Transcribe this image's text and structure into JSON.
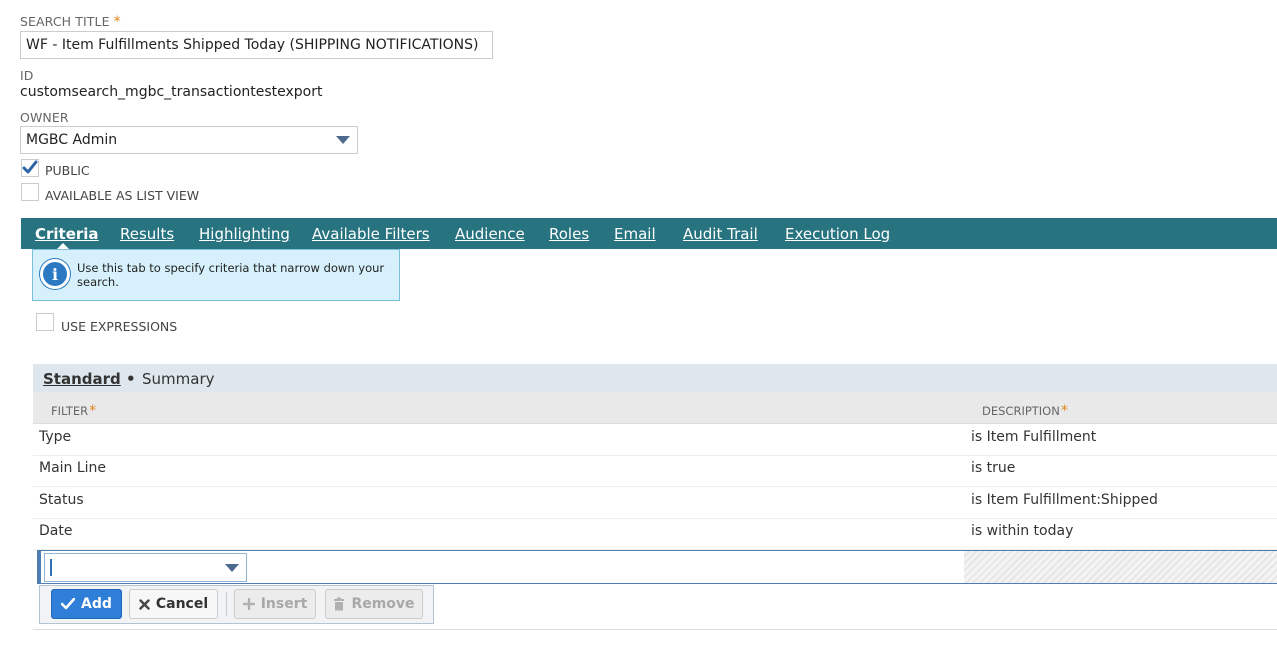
{
  "form": {
    "search_title_label": "SEARCH TITLE",
    "required_mark": "*",
    "search_title_value": "WF - Item Fulfillments Shipped Today (SHIPPING NOTIFICATIONS)",
    "id_label": "ID",
    "id_value": "customsearch_mgbc_transactiontestexport",
    "owner_label": "OWNER",
    "owner_value": "MGBC Admin",
    "public_label": "PUBLIC",
    "public_checked": true,
    "list_view_label": "AVAILABLE AS LIST VIEW",
    "list_view_checked": false
  },
  "tabs": [
    {
      "label": "Criteria",
      "active": true
    },
    {
      "label": "Results"
    },
    {
      "label": "Highlighting"
    },
    {
      "label": "Available Filters"
    },
    {
      "label": "Audience"
    },
    {
      "label": "Roles"
    },
    {
      "label": "Email"
    },
    {
      "label": "Audit Trail"
    },
    {
      "label": "Execution Log"
    }
  ],
  "info": {
    "icon": "info-icon",
    "text": "Use this tab to specify criteria that narrow down your search."
  },
  "use_expressions_label": "USE EXPRESSIONS",
  "subtabs": {
    "standard": "Standard",
    "standard_marker": "•",
    "summary": "Summary"
  },
  "table": {
    "col_filter": "FILTER",
    "col_description": "DESCRIPTION",
    "required_mark": "*",
    "rows": [
      {
        "filter": "Type",
        "description": "is Item Fulfillment"
      },
      {
        "filter": "Main Line",
        "description": "is true"
      },
      {
        "filter": "Status",
        "description": "is Item Fulfillment:Shipped"
      },
      {
        "filter": "Date",
        "description": "is within today"
      }
    ]
  },
  "buttons": {
    "add": "Add",
    "cancel": "Cancel",
    "insert": "Insert",
    "remove": "Remove"
  },
  "colors": {
    "tabbar": "#27737f",
    "primary_button": "#2f7ed8",
    "required": "#e0841a"
  }
}
